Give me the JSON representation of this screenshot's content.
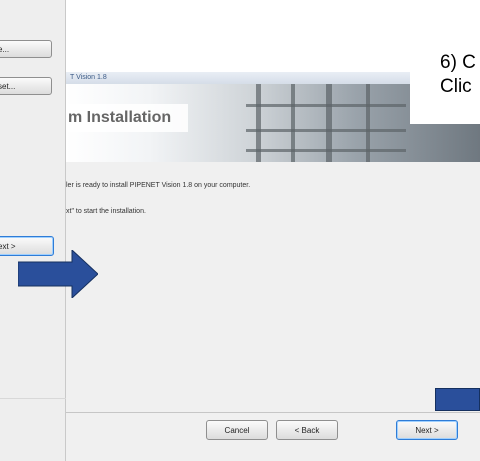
{
  "left_dialog": {
    "button1_label": "e...",
    "button2_label": "set...",
    "next_label": "ext >"
  },
  "installer": {
    "title": "T Vision 1.8",
    "header_title": "m Installation",
    "body_line1": "ler is ready to install PIPENET Vision 1.8 on your computer.",
    "body_line2": "xt\" to start the installation.",
    "cancel_label": "Cancel",
    "back_label": "< Back",
    "next_label": "Next >"
  },
  "instruction": {
    "step": "6) C",
    "sub": "Clic"
  },
  "colors": {
    "arrow": "#2a4f9b",
    "next_highlight": "#2f7cd6"
  }
}
